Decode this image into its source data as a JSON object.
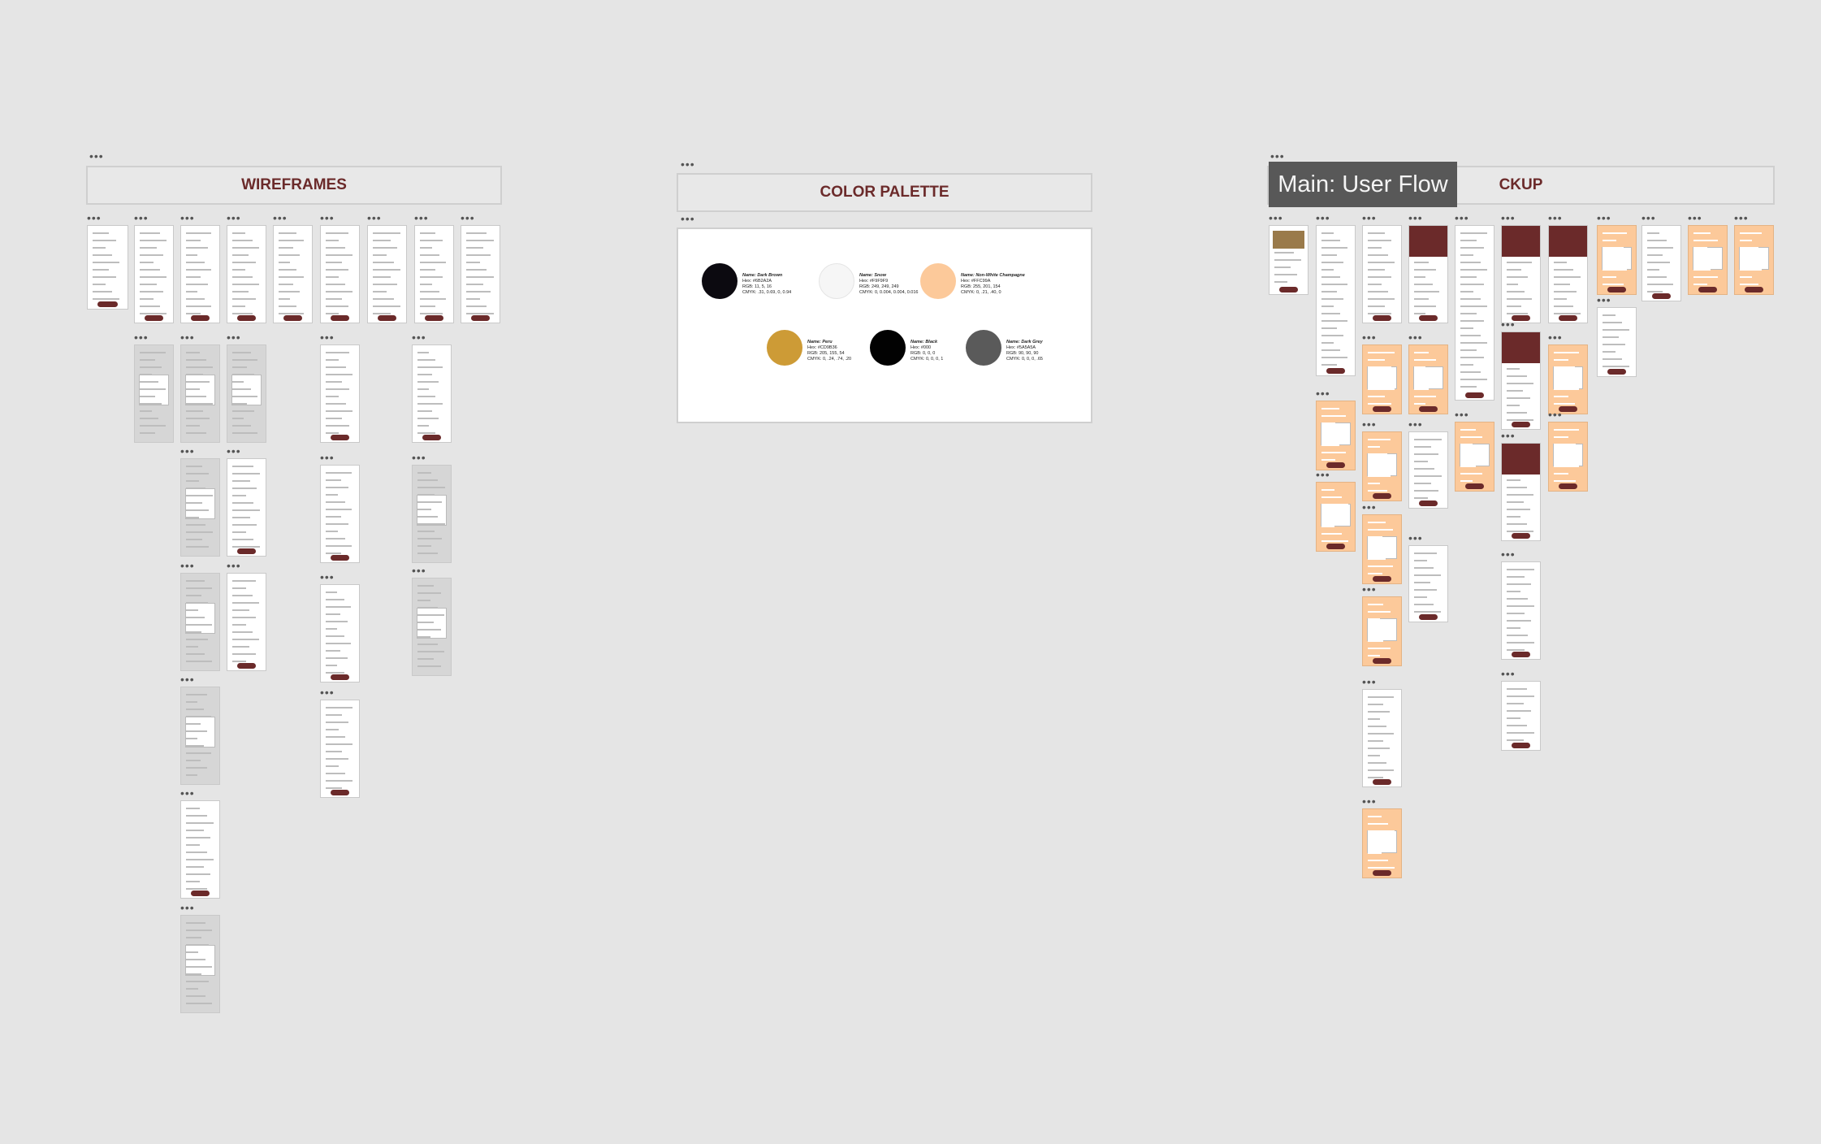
{
  "canvas": {
    "sections": [
      {
        "title": "WIREFRAMES"
      },
      {
        "title": "COLOR PALETTE"
      },
      {
        "title": "CKUP"
      }
    ],
    "tooltip": "Main: User Flow"
  },
  "palette": {
    "colors": [
      {
        "name": "Name: Dark Brown",
        "hex": "Hex: #6B2A2A",
        "rgb": "RGB: 11, 5, 16",
        "cmyk": "CMYK: .31, 0.69, 0, 0.94",
        "color": "#0c0a10"
      },
      {
        "name": "Name: Snow",
        "hex": "Hex: #F9F9F9",
        "rgb": "RGB: 249, 249, 249",
        "cmyk": "CMYK: 0, 0.004, 0.004, 0.016",
        "color": "#f6f6f6"
      },
      {
        "name": "Name: Non-White Champagne",
        "hex": "Hex: #FFC99A",
        "rgb": "RGB: 255, 201, 154",
        "cmyk": "CMYK: 0, .21, .40, 0",
        "color": "#fcc99a"
      },
      {
        "name": "Name: Peru",
        "hex": "Hex: #CD9B36",
        "rgb": "RGB: 205, 155, 54",
        "cmyk": "CMYK: 0, .24, .74, .20",
        "color": "#cd9b36"
      },
      {
        "name": "Name: Black",
        "hex": "Hex: #000",
        "rgb": "RGB: 0, 0, 0",
        "cmyk": "CMYK: 0, 0, 0, 1",
        "color": "#020202"
      },
      {
        "name": "Name: Dark Grey",
        "hex": "Hex: #5A5A5A",
        "rgb": "RGB: 90, 90, 90",
        "cmyk": "CMYK: 0, 0, 0, .65",
        "color": "#5a5a5a"
      }
    ]
  }
}
